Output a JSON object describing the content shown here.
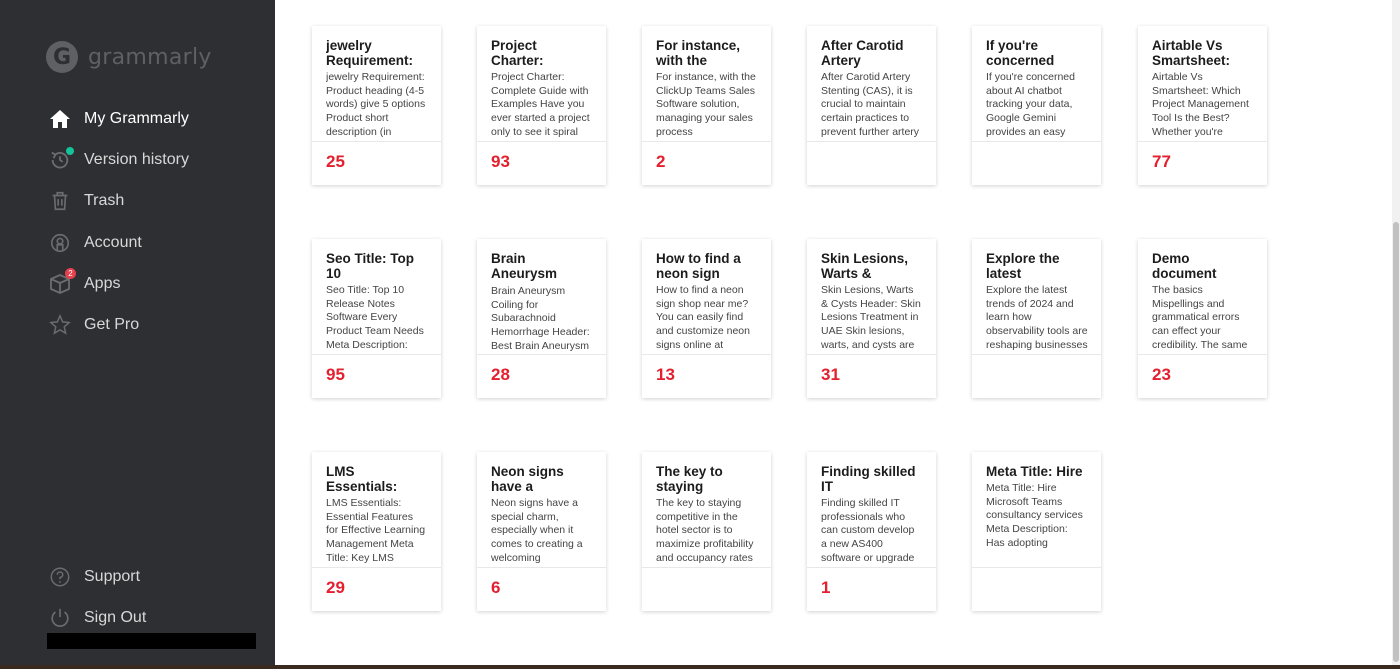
{
  "app": {
    "logo_text": "grammarly"
  },
  "sidebar": {
    "items": [
      {
        "label": "My Grammarly",
        "icon": "home-icon"
      },
      {
        "label": "Version history",
        "icon": "version-history-icon"
      },
      {
        "label": "Trash",
        "icon": "trash-icon"
      },
      {
        "label": "Account",
        "icon": "account-icon"
      },
      {
        "label": "Apps",
        "icon": "apps-icon",
        "badge": "2"
      },
      {
        "label": "Get Pro",
        "icon": "star-icon"
      }
    ],
    "footer": [
      {
        "label": "Support",
        "icon": "help-icon"
      },
      {
        "label": "Sign Out",
        "icon": "power-icon"
      }
    ]
  },
  "documents": [
    {
      "title": "jewelry Requirement:",
      "excerpt": "jewelry Requirement: Product heading (4-5 words) give 5 options Product short description (in",
      "score": "25"
    },
    {
      "title": "Project Charter:",
      "excerpt": "Project Charter: Complete Guide with Examples Have you ever started a project only to see it spiral out of control?",
      "score": "93"
    },
    {
      "title": "For instance, with the",
      "excerpt": "For instance, with the ClickUp Teams Sales Software solution, managing your sales process",
      "score": "2"
    },
    {
      "title": "After Carotid Artery",
      "excerpt": "After Carotid Artery Stenting (CAS), it is crucial to maintain certain practices to prevent further artery issues. Here are some self-care",
      "score": ""
    },
    {
      "title": "If you're concerned",
      "excerpt": "If you're concerned about AI chatbot tracking your data, Google Gemini provides an easy solution to address these worries. You",
      "score": ""
    },
    {
      "title": "Airtable Vs Smartsheet:",
      "excerpt": "Airtable Vs Smartsheet: Which Project Management Tool Is the Best? Whether you're",
      "score": "77"
    },
    {
      "title": "Seo Title: Top 10",
      "excerpt": "Seo Title: Top 10 Release Notes Software Every Product Team Needs Meta Description:",
      "score": "95"
    },
    {
      "title": "Brain Aneurysm Coiling",
      "excerpt": "Brain Aneurysm Coiling for Subarachnoid Hemorrhage Header: Best Brain Aneurysm",
      "score": "28"
    },
    {
      "title": "How to find a neon sign",
      "excerpt": "How to find a neon sign shop near me? You can easily find and customize neon signs online at",
      "score": "13"
    },
    {
      "title": "Skin Lesions, Warts &",
      "excerpt": "Skin Lesions, Warts & Cysts Header: Skin Lesions Treatment in UAE Skin lesions, warts, and cysts are",
      "score": "31"
    },
    {
      "title": "Explore the latest",
      "excerpt": "Explore the latest trends of 2024 and learn how observability tools are reshaping businesses with AI advancements,",
      "score": ""
    },
    {
      "title": "Demo document",
      "excerpt": "The basics Mispellings and grammatical errors can effect your credibility. The same",
      "score": "23"
    },
    {
      "title": "LMS Essentials:",
      "excerpt": "LMS Essentials: Essential Features for Effective Learning Management Meta Title: Key LMS Features for Effective",
      "score": "29"
    },
    {
      "title": "Neon signs have a",
      "excerpt": "Neon signs have a special charm, especially when it comes to creating a welcoming",
      "score": "6"
    },
    {
      "title": "The key to staying",
      "excerpt": "The key to staying competitive in the hotel sector is to maximize profitability and occupancy rates using effective hotel revenue",
      "score": ""
    },
    {
      "title": "Finding skilled IT",
      "excerpt": "Finding skilled IT professionals who can custom develop a new AS400 software or upgrade",
      "score": "1"
    },
    {
      "title": "Meta Title: Hire",
      "excerpt": "Meta Title: Hire Microsoft Teams consultancy services Meta Description: Has adopting Microsoft Teams posed any roadblocks for your",
      "score": ""
    }
  ],
  "colors": {
    "sidebar_bg": "#2d2f33",
    "score_red": "#e4202f",
    "badge_red": "#e4404e",
    "accent_teal": "#15c39a"
  }
}
